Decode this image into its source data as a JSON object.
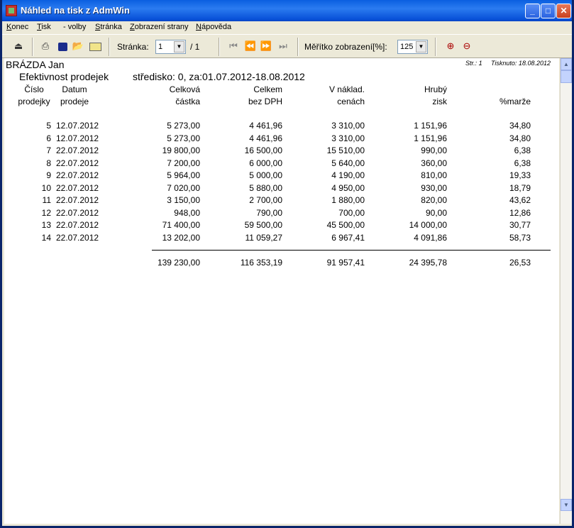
{
  "window": {
    "title": "Náhled na tisk z AdmWin"
  },
  "menu": {
    "items": [
      {
        "pre": "",
        "u": "K",
        "post": "onec"
      },
      {
        "pre": "",
        "u": "T",
        "post": "isk"
      },
      {
        "pre": "",
        "u": "",
        "post": "- volby"
      },
      {
        "pre": "",
        "u": "S",
        "post": "tránka"
      },
      {
        "pre": "",
        "u": "Z",
        "post": "obrazení strany"
      },
      {
        "pre": "",
        "u": "N",
        "post": "ápověda"
      }
    ]
  },
  "toolbar": {
    "page_label": "Stránka:",
    "page_value": "1",
    "page_total": "/ 1",
    "zoom_label": "Měřítko zobrazení[%]:",
    "zoom_value": "125"
  },
  "report": {
    "person": "BRÁZDA Jan",
    "page_info": "Str.: 1",
    "printed": "Tisknuto: 18.08.2012",
    "title": "Efektivnost prodejek",
    "subtitle": "středisko:  0, za:01.07.2012-18.08.2012",
    "headers": {
      "no": [
        "Číslo",
        "prodejky"
      ],
      "date": [
        "Datum",
        "prodeje"
      ],
      "amount": [
        "Celková",
        "částka"
      ],
      "net": [
        "Celkem",
        "bez DPH"
      ],
      "cost": [
        "V náklad.",
        "cenách"
      ],
      "gross": [
        "Hrubý",
        "zisk"
      ],
      "margin": [
        "",
        "%marže"
      ]
    },
    "rows": [
      {
        "no": "5",
        "date": "12.07.2012",
        "amount": "5 273,00",
        "net": "4 461,96",
        "cost": "3 310,00",
        "gross": "1 151,96",
        "margin": "34,80"
      },
      {
        "no": "6",
        "date": "12.07.2012",
        "amount": "5 273,00",
        "net": "4 461,96",
        "cost": "3 310,00",
        "gross": "1 151,96",
        "margin": "34,80"
      },
      {
        "no": "7",
        "date": "22.07.2012",
        "amount": "19 800,00",
        "net": "16 500,00",
        "cost": "15 510,00",
        "gross": "990,00",
        "margin": "6,38"
      },
      {
        "no": "8",
        "date": "22.07.2012",
        "amount": "7 200,00",
        "net": "6 000,00",
        "cost": "5 640,00",
        "gross": "360,00",
        "margin": "6,38"
      },
      {
        "no": "9",
        "date": "22.07.2012",
        "amount": "5 964,00",
        "net": "5 000,00",
        "cost": "4 190,00",
        "gross": "810,00",
        "margin": "19,33"
      },
      {
        "no": "10",
        "date": "22.07.2012",
        "amount": "7 020,00",
        "net": "5 880,00",
        "cost": "4 950,00",
        "gross": "930,00",
        "margin": "18,79"
      },
      {
        "no": "11",
        "date": "22.07.2012",
        "amount": "3 150,00",
        "net": "2 700,00",
        "cost": "1 880,00",
        "gross": "820,00",
        "margin": "43,62"
      },
      {
        "no": "12",
        "date": "22.07.2012",
        "amount": "948,00",
        "net": "790,00",
        "cost": "700,00",
        "gross": "90,00",
        "margin": "12,86"
      },
      {
        "no": "13",
        "date": "22.07.2012",
        "amount": "71 400,00",
        "net": "59 500,00",
        "cost": "45 500,00",
        "gross": "14 000,00",
        "margin": "30,77"
      },
      {
        "no": "14",
        "date": "22.07.2012",
        "amount": "13 202,00",
        "net": "11 059,27",
        "cost": "6 967,41",
        "gross": "4 091,86",
        "margin": "58,73"
      }
    ],
    "totals": {
      "amount": "139 230,00",
      "net": "116 353,19",
      "cost": "91 957,41",
      "gross": "24 395,78",
      "margin": "26,53"
    }
  }
}
